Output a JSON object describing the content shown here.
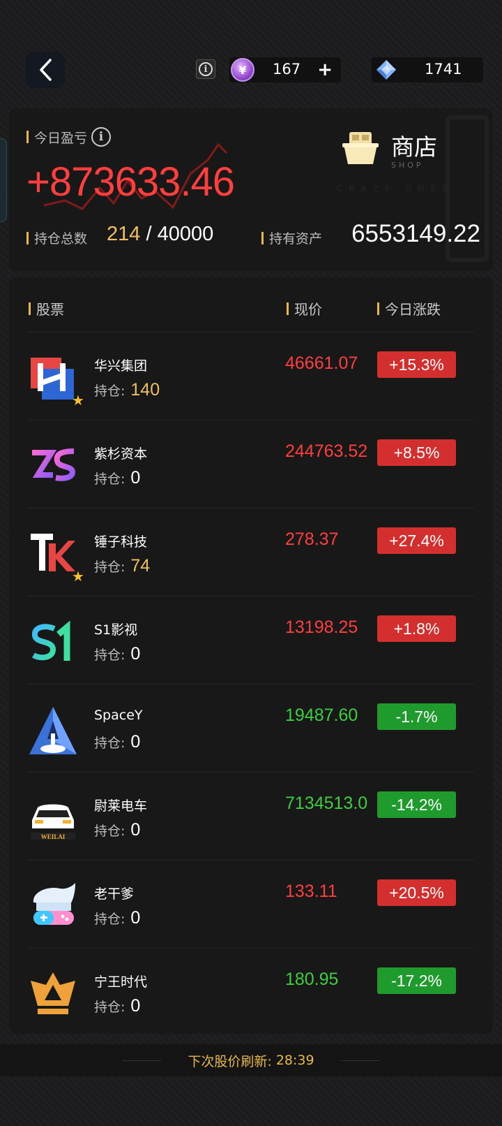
{
  "topbar": {
    "coin_value": "167",
    "gem_value": "1741"
  },
  "summary": {
    "pl_label": "今日盈亏",
    "pl_value": "+873633.46",
    "positions_label": "持仓总数",
    "positions_held": "214",
    "positions_sep": " / ",
    "positions_max": "40000",
    "assets_label": "持有资产",
    "assets_value": "6553149.22",
    "shop_label": "商店",
    "shop_sub": "SHOP",
    "watermark": "CRAZY ONES"
  },
  "table": {
    "col_stock": "股票",
    "col_price": "现价",
    "col_change": "今日涨跌",
    "hold_label": "持仓:",
    "rows": [
      {
        "name": "华兴集团",
        "holding": "140",
        "price": "46661.07",
        "change": "+15.3%",
        "direction": "up",
        "starred": true,
        "logo": "huaxing-logo"
      },
      {
        "name": "紫杉资本",
        "holding": "0",
        "price": "244763.52",
        "change": "+8.5%",
        "direction": "up",
        "starred": false,
        "logo": "zishan-logo"
      },
      {
        "name": "锤子科技",
        "holding": "74",
        "price": "278.37",
        "change": "+27.4%",
        "direction": "up",
        "starred": true,
        "logo": "chuizi-logo"
      },
      {
        "name": "S1影视",
        "holding": "0",
        "price": "13198.25",
        "change": "+1.8%",
        "direction": "up",
        "starred": false,
        "logo": "s1-logo"
      },
      {
        "name": "SpaceY",
        "holding": "0",
        "price": "19487.60",
        "change": "-1.7%",
        "direction": "down",
        "starred": false,
        "logo": "spacey-logo"
      },
      {
        "name": "尉莱电车",
        "holding": "0",
        "price": "7134513.0",
        "change": "-14.2%",
        "direction": "down",
        "starred": false,
        "logo": "weilai-logo"
      },
      {
        "name": "老干爹",
        "holding": "0",
        "price": "133.11",
        "change": "+20.5%",
        "direction": "up",
        "starred": false,
        "logo": "laogandie-logo"
      },
      {
        "name": "宁王时代",
        "holding": "0",
        "price": "180.95",
        "change": "-17.2%",
        "direction": "down",
        "starred": false,
        "logo": "ningwang-logo"
      }
    ]
  },
  "footer": {
    "refresh_label": "下次股价刷新:",
    "refresh_time": "28:39"
  },
  "colors": {
    "up": "#ff3e3e",
    "down": "#3ecf3e",
    "gold": "#f0c060",
    "accent_bar": "#e8b84a"
  }
}
